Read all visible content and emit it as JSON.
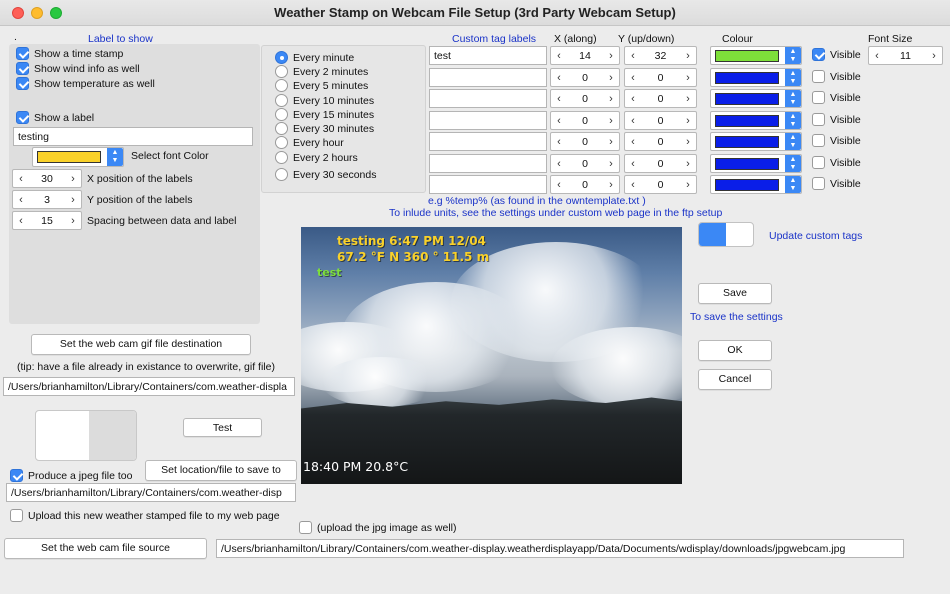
{
  "window": {
    "title": "Weather Stamp on Webcam File Setup (3rd Party Webcam Setup)"
  },
  "labels_section": {
    "header": "Label to show",
    "dot": ".",
    "checks": [
      {
        "label": "Show a time stamp",
        "checked": true
      },
      {
        "label": "Show wind info as well",
        "checked": true
      },
      {
        "label": "Show temperature as well",
        "checked": true
      }
    ],
    "show_label": {
      "label": "Show a label",
      "checked": true
    },
    "label_text": "testing",
    "font_color": {
      "label": "Select font Color",
      "color": "#f9d12a"
    },
    "x_pos": {
      "value": "30",
      "label": "X position of the labels"
    },
    "y_pos": {
      "value": "3",
      "label": "Y position of the labels"
    },
    "spacing": {
      "value": "15",
      "label": "Spacing between data and label"
    }
  },
  "interval": {
    "options": [
      {
        "label": "Every minute",
        "selected": true
      },
      {
        "label": "Every 2 minutes",
        "selected": false
      },
      {
        "label": "Every 5 minutes",
        "selected": false
      },
      {
        "label": "Every 10 minutes",
        "selected": false
      },
      {
        "label": "Every 15 minutes",
        "selected": false
      },
      {
        "label": "Every 30 minutes",
        "selected": false
      },
      {
        "label": "Every hour",
        "selected": false
      },
      {
        "label": "Every 2 hours",
        "selected": false
      },
      {
        "label": "Every 30 seconds",
        "selected": false
      }
    ]
  },
  "custom_tags": {
    "headers": {
      "labels": "Custom tag labels",
      "x": "X (along)",
      "y": "Y (up/down)",
      "colour": "Colour",
      "font_size": "Font Size"
    },
    "font_size": "11",
    "rows": [
      {
        "label": "test",
        "x": "14",
        "y": "32",
        "color": "#7ee03a",
        "visible": true,
        "visible_label": "Visible"
      },
      {
        "label": "",
        "x": "0",
        "y": "0",
        "color": "#0a1ee8",
        "visible": false,
        "visible_label": "Visible"
      },
      {
        "label": "",
        "x": "0",
        "y": "0",
        "color": "#0a1ee8",
        "visible": false,
        "visible_label": "Visible"
      },
      {
        "label": "",
        "x": "0",
        "y": "0",
        "color": "#0a1ee8",
        "visible": false,
        "visible_label": "Visible"
      },
      {
        "label": "",
        "x": "0",
        "y": "0",
        "color": "#0a1ee8",
        "visible": false,
        "visible_label": "Visible"
      },
      {
        "label": "",
        "x": "0",
        "y": "0",
        "color": "#0a1ee8",
        "visible": false,
        "visible_label": "Visible"
      },
      {
        "label": "",
        "x": "0",
        "y": "0",
        "color": "#0a1ee8",
        "visible": false,
        "visible_label": "Visible"
      }
    ],
    "hint1": "e.g %temp% (as found in the owntemplate.txt )",
    "hint2": "To inlude units, see the settings under custom web page in the ftp setup",
    "update_label": "Update custom tags",
    "update_on": true
  },
  "preview": {
    "stamp_line1": "testing 6:47 PM  12/04",
    "stamp_line2": "67.2 °F   N  360 °  11.5 m",
    "stamp_label": "test",
    "overlay": "18:40 PM 20.8°C"
  },
  "actions": {
    "save": "Save",
    "save_hint": "To save the settings",
    "ok": "OK",
    "cancel": "Cancel",
    "test": "Test"
  },
  "files": {
    "set_gif_dest": "Set the web cam gif file destination",
    "tip": "(tip: have a file already in existance to overwrite, gif file)",
    "gif_path": "/Users/brianhamilton/Library/Containers/com.weather-displa",
    "produce_jpeg": {
      "label": "Produce a jpeg file too",
      "checked": true
    },
    "set_location": "Set location/file to save to",
    "jpeg_path": "/Users/brianhamilton/Library/Containers/com.weather-disp",
    "upload": {
      "label": "Upload this new weather stamped file to my web page",
      "checked": false
    },
    "upload_jpg": {
      "label": "(upload the jpg image as well)",
      "checked": false
    },
    "set_source": "Set the web cam file source",
    "source_path": "/Users/brianhamilton/Library/Containers/com.weather-display.weatherdisplayapp/Data/Documents/wdisplay/downloads/jpgwebcam.jpg"
  }
}
